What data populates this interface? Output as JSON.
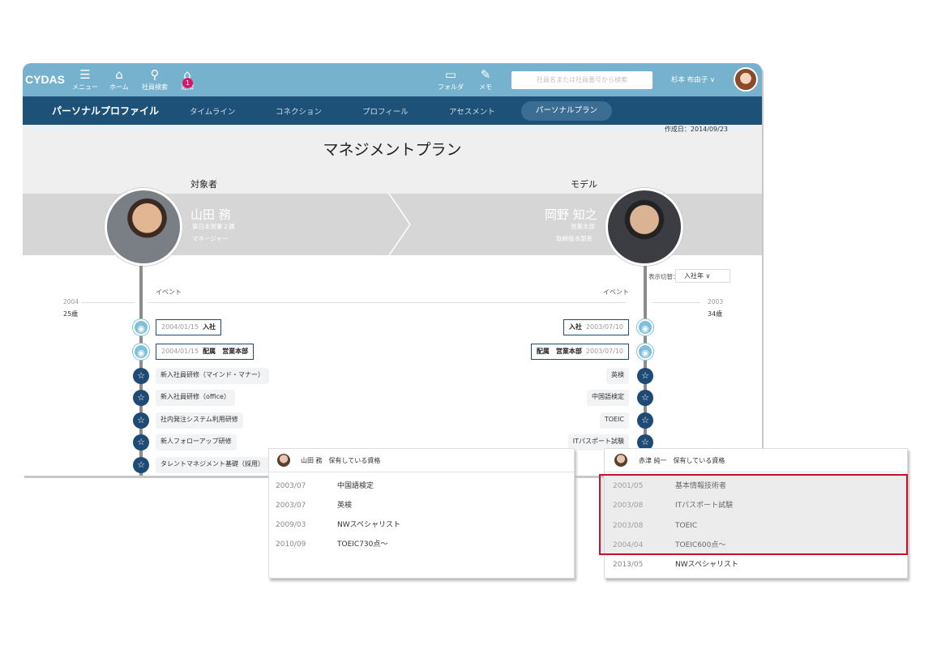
{
  "app": {
    "logo": "CYDAS"
  },
  "toolbar": {
    "menu": "メニュー",
    "home": "ホーム",
    "search": "社員検索",
    "notify": "通知",
    "notify_count": "1",
    "folder": "フォルダ",
    "memo": "メモ",
    "search_placeholder": "社員名または社員番号から検索",
    "user": "杉本 布由子 ∨"
  },
  "nav": {
    "title": "パーソナルプロファイル",
    "tabs": [
      "タイムライン",
      "コネクション",
      "プロフィール",
      "アセスメント",
      "パーソナルプラン"
    ],
    "active_index": 4
  },
  "plan": {
    "created": "作成日：2014/09/23",
    "title": "マネジメントプラン",
    "target_label": "対象者",
    "model_label": "モデル",
    "target": {
      "name": "山田 務",
      "dept": "東日本営業２課",
      "role": "マネージャー"
    },
    "model": {
      "name": "岡野 知之",
      "dept": "営業本部",
      "role": "取締役本部長"
    },
    "display_label": "表示切替：",
    "display_value": "入社年 ∨",
    "event_header": "イベント",
    "left_year": "2004",
    "left_age": "25歳",
    "right_year": "2003",
    "right_age": "34歳",
    "left_events": [
      {
        "type": "pin",
        "date": "2004/01/15",
        "label": "入社"
      },
      {
        "type": "pin",
        "date": "2004/01/15",
        "label": "配属　営業本部"
      },
      {
        "type": "star",
        "label": "新入社員研修（マインド・マナー）"
      },
      {
        "type": "star",
        "label": "新入社員研修（office）"
      },
      {
        "type": "star",
        "label": "社内発注システム利用研修"
      },
      {
        "type": "star",
        "label": "新人フォローアップ研修"
      },
      {
        "type": "star",
        "label": "タレントマネジメント基礎（採用）"
      }
    ],
    "right_events": [
      {
        "type": "pin",
        "date": "2003/07/10",
        "label": "入社"
      },
      {
        "type": "pin",
        "date": "2003/07/10",
        "label": "配属　営業本部"
      },
      {
        "type": "star",
        "label": "英検"
      },
      {
        "type": "star",
        "label": "中国語検定"
      },
      {
        "type": "star",
        "label": "TOEIC"
      },
      {
        "type": "star",
        "label": "ITパスポート試験"
      }
    ]
  },
  "left_card": {
    "title": "山田 務　保有している資格",
    "rows": [
      {
        "year": "2003/07",
        "name": "中国語検定"
      },
      {
        "year": "2003/07",
        "name": "英検"
      },
      {
        "year": "2009/03",
        "name": "NWスペシャリスト"
      },
      {
        "year": "2010/09",
        "name": "TOEIC730点～"
      }
    ]
  },
  "right_card": {
    "title": "赤津 純一　保有している資格",
    "rows": [
      {
        "year": "2001/05",
        "name": "基本情報技術者"
      },
      {
        "year": "2003/08",
        "name": "ITパスポート試験"
      },
      {
        "year": "2003/08",
        "name": "TOEIC"
      },
      {
        "year": "2004/04",
        "name": "TOEIC600点～"
      },
      {
        "year": "2013/05",
        "name": "NWスペシャリスト"
      }
    ]
  },
  "colors": {
    "topbar": "#76b2cd",
    "nav": "#1e5177",
    "highlight": "#c8102e",
    "node_star": "#1e4b75",
    "node_pin": "#7ec0dc"
  }
}
